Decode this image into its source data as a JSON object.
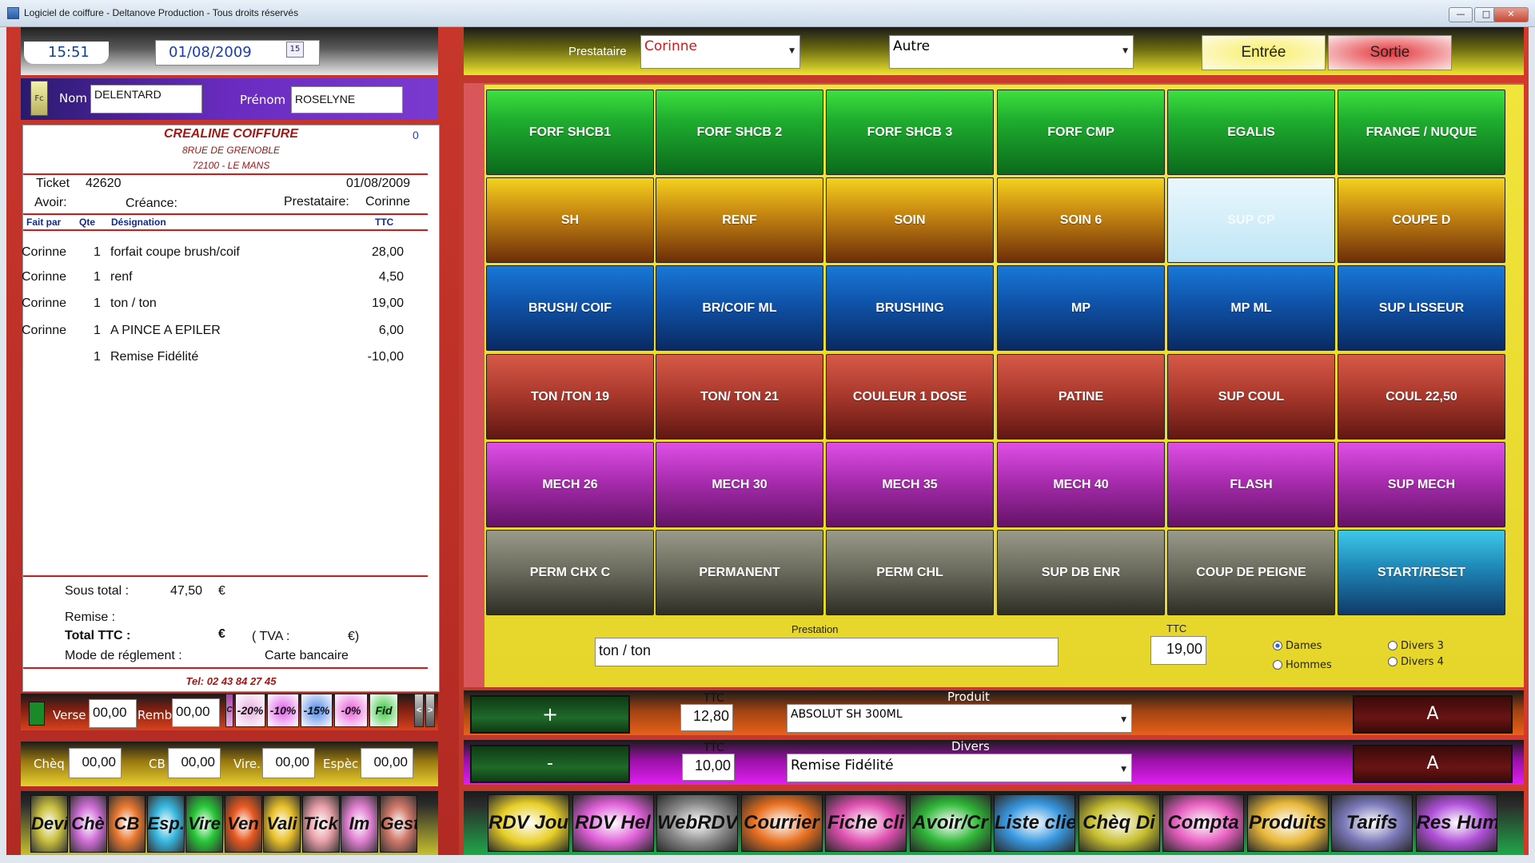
{
  "window": {
    "title": "Logiciel de coiffure - Deltanove Production - Tous droits réservés"
  },
  "header": {
    "time": "15:51",
    "date": "01/08/2009",
    "date_icon": "15"
  },
  "client": {
    "fc_label": "Fc",
    "nom_label": "Nom",
    "nom": "DELENTARD",
    "prenom_label": "Prénom",
    "prenom": "ROSELYNE"
  },
  "ticket": {
    "shop_name": "CREALINE COIFFURE",
    "address1": "8RUE DE GRENOBLE",
    "address2": "72100 - LE MANS",
    "counter": "0",
    "ticket_label": "Ticket",
    "ticket_no": "42620",
    "ticket_date": "01/08/2009",
    "avoir_label": "Avoir:",
    "creance_label": "Créance:",
    "prestataire_label": "Prestataire:",
    "prestataire": "Corinne",
    "cols": {
      "fait_par": "Fait par",
      "qte": "Qte",
      "designation": "Désignation",
      "ttc": "TTC"
    },
    "lines": [
      {
        "by": "Corinne",
        "qty": "1",
        "desc": "forfait coupe brush/coif",
        "ttc": "28,00"
      },
      {
        "by": "Corinne",
        "qty": "1",
        "desc": "renf",
        "ttc": "4,50"
      },
      {
        "by": "Corinne",
        "qty": "1",
        "desc": "ton / ton",
        "ttc": "19,00"
      },
      {
        "by": "Corinne",
        "qty": "1",
        "desc": "A PINCE A EPILER",
        "ttc": "6,00"
      },
      {
        "by": "",
        "qty": "1",
        "desc": "Remise Fidélité",
        "ttc": "-10,00"
      }
    ],
    "sous_total_label": "Sous total :",
    "sous_total": "47,50",
    "euro": "€",
    "remise_label": "Remise :",
    "total_label": "Total TTC :",
    "tva_open": "( TVA :",
    "tva_close": "€)",
    "mode_label": "Mode de réglement :",
    "mode": "Carte bancaire",
    "tel": "Tel: 02 43 84 27 45"
  },
  "payment": {
    "verse_label": "Verse",
    "verse": "00,00",
    "remb_label": "Remb",
    "remb": "00,00",
    "discounts": [
      "C",
      "-20%",
      "-10%",
      "-15%",
      "-0%",
      "Fid",
      "<",
      ">"
    ],
    "cheq_label": "Chèq",
    "cheq": "00,00",
    "cb_label": "CB",
    "cb": "00,00",
    "vire_label": "Vire.",
    "vire": "00,00",
    "espec_label": "Espèc",
    "espec": "00,00"
  },
  "left_bottom": [
    "Devi",
    "Chè",
    "CB",
    "Esp.",
    "Vire",
    "Ven",
    "Vali",
    "Tick",
    "Im",
    "Gest"
  ],
  "topbar": {
    "prestataire_label": "Prestataire",
    "prestataire": "Corinne",
    "autre": "Autre",
    "entree": "Entrée",
    "sortie": "Sortie"
  },
  "grid": [
    [
      "FORF SHCB1",
      "FORF SHCB 2",
      "FORF SHCB 3",
      "FORF CMP",
      "EGALIS",
      "FRANGE / NUQUE"
    ],
    [
      "SH",
      "RENF",
      "SOIN",
      "SOIN 6",
      "SUP  CP",
      "COUPE D"
    ],
    [
      "BRUSH/ COIF",
      "BR/COIF ML",
      "BRUSHING",
      "MP",
      "MP ML",
      "SUP LISSEUR"
    ],
    [
      "TON /TON 19",
      "TON/ TON 21",
      "COULEUR 1 DOSE",
      "PATINE",
      "SUP COUL",
      "COUL 22,50"
    ],
    [
      "MECH 26",
      "MECH 30",
      "MECH 35",
      "MECH 40",
      "FLASH",
      "SUP MECH"
    ],
    [
      "PERM CHX C",
      "PERMANENT",
      "PERM CHL",
      "SUP DB ENR",
      "COUP DE PEIGNE",
      "START/RESET"
    ]
  ],
  "prestation": {
    "label": "Prestation",
    "value": "ton / ton",
    "ttc_label": "TTC",
    "ttc": "19,00",
    "dames": "Dames",
    "hommes": "Hommes",
    "divers3": "Divers 3",
    "divers4": "Divers 4"
  },
  "produit": {
    "plus": "+",
    "ttc_label": "TTC",
    "ttc": "12,80",
    "label": "Produit",
    "value": "ABSOLUT SH 300ML",
    "a": "A"
  },
  "divers": {
    "minus": "-",
    "ttc_label": "TTC",
    "ttc": "10,00",
    "label": "Divers",
    "value": "Remise Fidélité",
    "a": "A"
  },
  "bottom_nav": [
    "RDV Jou",
    "RDV Hel",
    "WebRDV",
    "Courrier",
    "Fiche cli",
    "Avoir/Cr",
    "Liste clie",
    "Chèq Di",
    "Compta",
    "Produits",
    "Tarifs",
    "Res Hum"
  ]
}
